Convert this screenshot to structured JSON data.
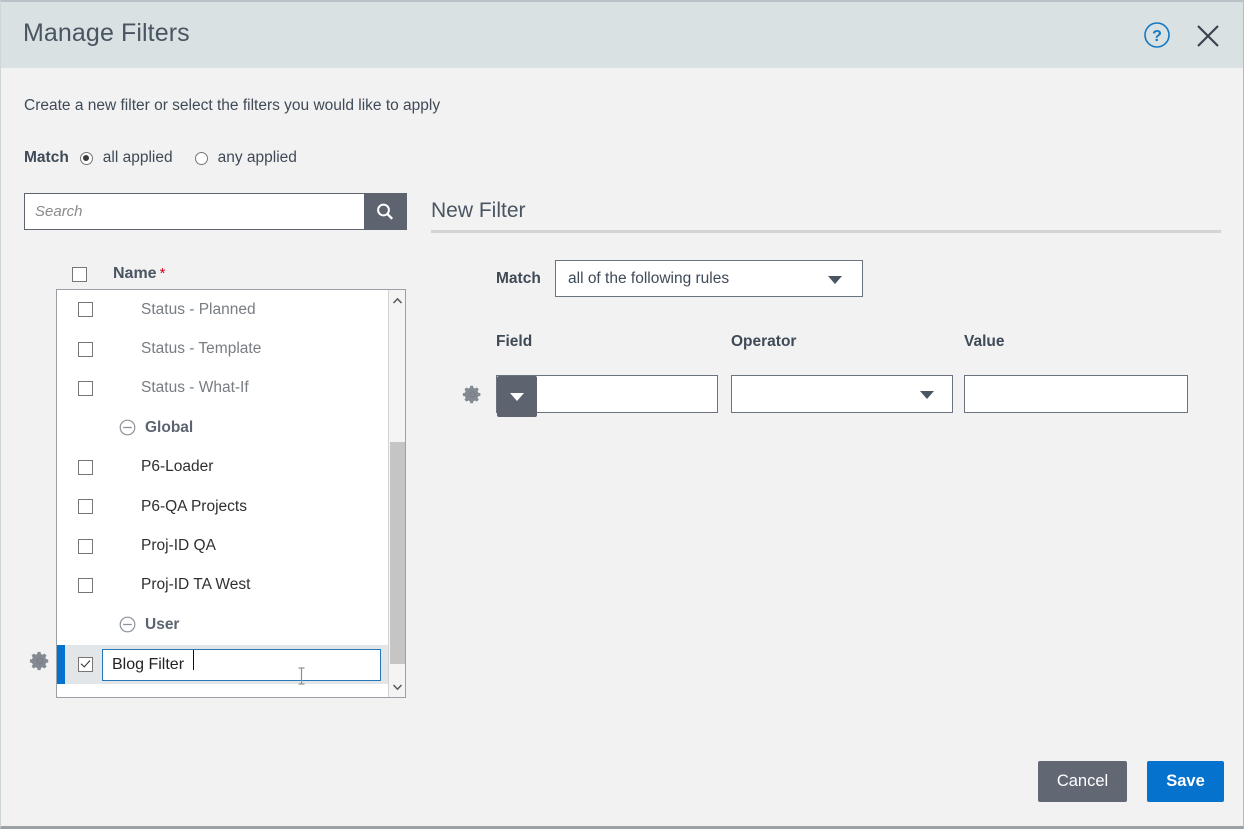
{
  "header": {
    "title": "Manage Filters",
    "help_icon": "help-circle-icon",
    "close_icon": "close-icon"
  },
  "intro": {
    "text": "Create a new filter or select the filters you would like to apply"
  },
  "match_applied": {
    "label": "Match",
    "options": [
      {
        "label": "all applied",
        "selected": true
      },
      {
        "label": "any applied",
        "selected": false
      }
    ]
  },
  "search": {
    "value": "",
    "placeholder": "Search",
    "icon": "search-icon"
  },
  "list": {
    "header": {
      "label": "Name",
      "required_marker": "*",
      "checked": false
    },
    "rows": [
      {
        "type": "item",
        "label": "Status - Planned",
        "checked": false,
        "style": "muted"
      },
      {
        "type": "item",
        "label": "Status - Template",
        "checked": false,
        "style": "muted"
      },
      {
        "type": "item",
        "label": "Status - What-If",
        "checked": false,
        "style": "muted"
      },
      {
        "type": "group",
        "label": "Global",
        "toggle_icon": "circle-minus-icon"
      },
      {
        "type": "item",
        "label": "P6-Loader",
        "checked": false,
        "style": "normal"
      },
      {
        "type": "item",
        "label": "P6-QA Projects",
        "checked": false,
        "style": "normal"
      },
      {
        "type": "item",
        "label": "Proj-ID QA",
        "checked": false,
        "style": "normal"
      },
      {
        "type": "item",
        "label": "Proj-ID TA West",
        "checked": false,
        "style": "normal"
      },
      {
        "type": "group",
        "label": "User",
        "toggle_icon": "circle-minus-icon"
      },
      {
        "type": "editing",
        "label": "Blog Filter",
        "checked": true,
        "style": "normal"
      }
    ],
    "row_gear_icon": "gear-icon",
    "scrollbar": {
      "up_icon": "chevron-up-icon",
      "down_icon": "chevron-down-icon"
    }
  },
  "panel": {
    "title": "New Filter",
    "match": {
      "label": "Match",
      "selected": "all of the following rules",
      "dropdown_icon": "chevron-down-icon"
    },
    "columns": {
      "field": "Field",
      "operator": "Operator",
      "value": "Value"
    },
    "rule": {
      "gear_icon": "gear-icon",
      "field_value": "",
      "field_dropdown_icon": "chevron-down-icon",
      "operator_value": "",
      "operator_dropdown_icon": "chevron-down-icon",
      "value_value": "",
      "value_placeholder": ""
    }
  },
  "footer": {
    "cancel_label": "Cancel",
    "save_label": "Save"
  },
  "colors": {
    "header_bg": "#dae1e3",
    "body_bg": "#f2f2f2",
    "accent_blue": "#0572ce",
    "cancel_gray": "#616874",
    "dark_slate": "#5d6470",
    "required_red": "#d0021b"
  }
}
